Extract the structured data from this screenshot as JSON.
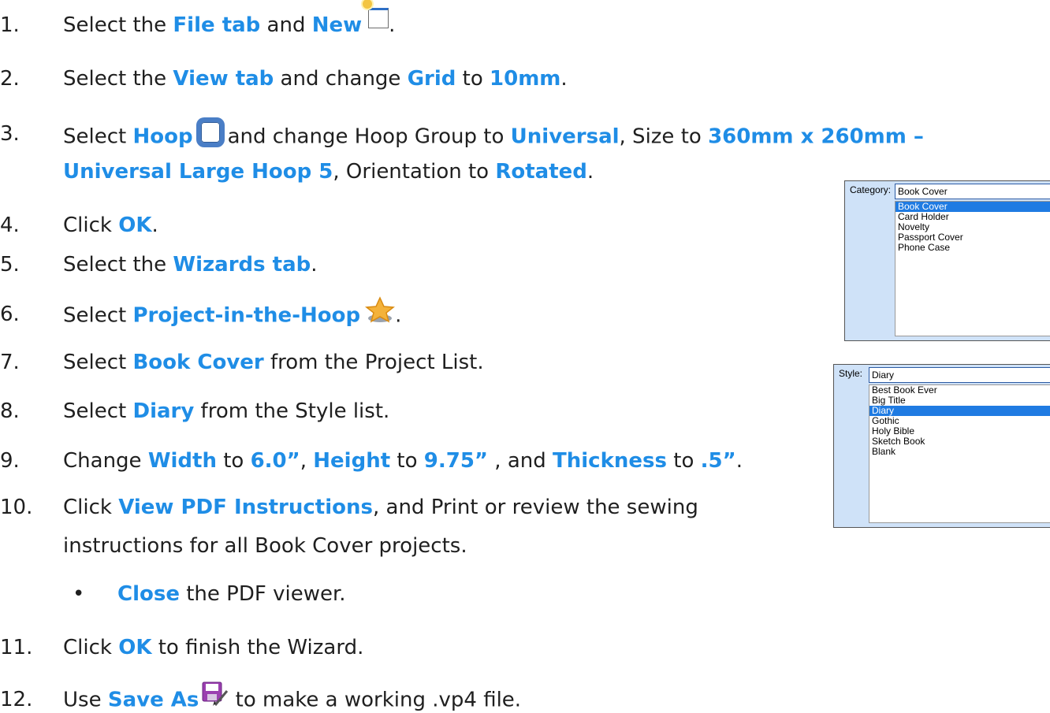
{
  "steps": [
    {
      "num": "1.",
      "parts": [
        {
          "t": "Select the "
        },
        {
          "t": "File tab",
          "h": true
        },
        {
          "t": " and "
        },
        {
          "t": "New",
          "h": true
        },
        {
          "icon": "new"
        },
        {
          "t": "."
        }
      ]
    },
    {
      "num": "2.",
      "parts": [
        {
          "t": "Select the "
        },
        {
          "t": "View tab",
          "h": true
        },
        {
          "t": " and change "
        },
        {
          "t": "Grid",
          "h": true
        },
        {
          "t": " to "
        },
        {
          "t": "10mm",
          "h": true
        },
        {
          "t": "."
        }
      ]
    },
    {
      "num": "3.",
      "parts": [
        {
          "t": "Select "
        },
        {
          "t": "Hoop",
          "h": true
        },
        {
          "icon": "hoop"
        },
        {
          "t": "and change Hoop Group to "
        },
        {
          "t": "Universal",
          "h": true
        },
        {
          "t": ", Size to "
        },
        {
          "t": "360mm x 260mm –",
          "h": true
        }
      ]
    },
    {
      "num": "",
      "parts": [
        {
          "t": "Universal Large Hoop 5",
          "h": true
        },
        {
          "t": ", Orientation to "
        },
        {
          "t": "Rotated",
          "h": true
        },
        {
          "t": "."
        }
      ]
    },
    {
      "num": "4.",
      "parts": [
        {
          "t": "Click "
        },
        {
          "t": "OK",
          "h": true
        },
        {
          "t": "."
        }
      ]
    },
    {
      "num": "5.",
      "parts": [
        {
          "t": "Select the "
        },
        {
          "t": "Wizards tab",
          "h": true
        },
        {
          "t": "."
        }
      ]
    },
    {
      "num": "6.",
      "parts": [
        {
          "t": "Select "
        },
        {
          "t": "Project-in-the-Hoop",
          "h": true
        },
        {
          "icon": "star"
        },
        {
          "t": "."
        }
      ]
    },
    {
      "num": "7.",
      "parts": [
        {
          "t": "Select "
        },
        {
          "t": "Book Cover",
          "h": true
        },
        {
          "t": " from the Project List."
        }
      ]
    },
    {
      "num": "8.",
      "parts": [
        {
          "t": "Select "
        },
        {
          "t": "Diary",
          "h": true
        },
        {
          "t": " from the Style list."
        }
      ]
    },
    {
      "num": "9.",
      "parts": [
        {
          "t": "Change "
        },
        {
          "t": "Width",
          "h": true
        },
        {
          "t": " to "
        },
        {
          "t": "6.0”",
          "h": true
        },
        {
          "t": ", "
        },
        {
          "t": "Height",
          "h": true
        },
        {
          "t": " to "
        },
        {
          "t": "9.75”",
          "h": true
        },
        {
          "t": " , and "
        },
        {
          "t": "Thickness",
          "h": true
        },
        {
          "t": " to "
        },
        {
          "t": ".5”",
          "h": true
        },
        {
          "t": "."
        }
      ]
    },
    {
      "num": "10.",
      "parts": [
        {
          "t": "Click "
        },
        {
          "t": "View PDF Instructions",
          "h": true
        },
        {
          "t": ", and Print or review the sewing"
        }
      ]
    },
    {
      "num": "",
      "parts": [
        {
          "t": "instructions for all Book Cover projects."
        }
      ]
    },
    {
      "num": "",
      "bullet": "•",
      "parts": [
        {
          "t": "Close",
          "h": true
        },
        {
          "t": " the PDF viewer."
        }
      ]
    },
    {
      "num": "11.",
      "parts": [
        {
          "t": "Click "
        },
        {
          "t": "OK",
          "h": true
        },
        {
          "t": " to finish the Wizard."
        }
      ]
    },
    {
      "num": "12.",
      "parts": [
        {
          "t": "Use "
        },
        {
          "t": "Save As",
          "h": true
        },
        {
          "icon": "save"
        },
        {
          "t": " to make a working .vp4 file."
        }
      ]
    }
  ],
  "category_panel": {
    "label": "Category:",
    "value": "Book Cover",
    "items": [
      "Book Cover",
      "Card Holder",
      "Novelty",
      "Passport Cover",
      "Phone Case"
    ],
    "selected": 0
  },
  "style_panel": {
    "label": "Style:",
    "value": "Diary",
    "items": [
      "Best Book Ever",
      "Big Title",
      "Diary",
      "Gothic",
      "Holy Bible",
      "Sketch Book",
      "Blank"
    ],
    "selected": 2
  },
  "colors": {
    "highlight": "#1f8de6",
    "selection": "#1f7be2",
    "panel_bg": "#cfe2f8"
  }
}
